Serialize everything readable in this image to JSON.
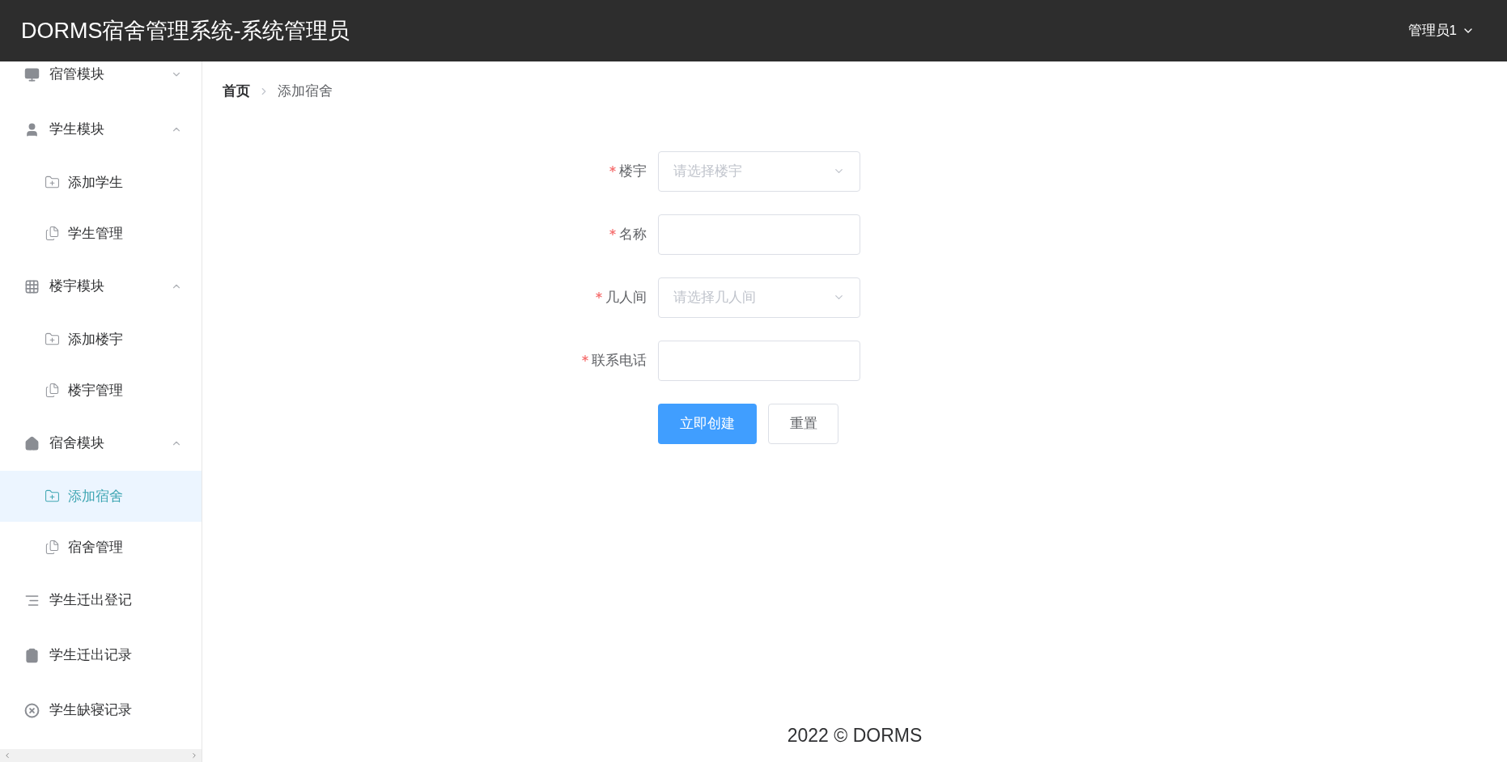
{
  "header": {
    "title": "DORMS宿舍管理系统-系统管理员",
    "user": "管理员1"
  },
  "sidebar": {
    "items": [
      {
        "label": "宿管模块",
        "expanded": false
      },
      {
        "label": "学生模块",
        "expanded": true,
        "children": [
          {
            "label": "添加学生",
            "kind": "add",
            "selected": false
          },
          {
            "label": "学生管理",
            "kind": "manage",
            "selected": false
          }
        ]
      },
      {
        "label": "楼宇模块",
        "expanded": true,
        "children": [
          {
            "label": "添加楼宇",
            "kind": "add",
            "selected": false
          },
          {
            "label": "楼宇管理",
            "kind": "manage",
            "selected": false
          }
        ]
      },
      {
        "label": "宿舍模块",
        "expanded": true,
        "children": [
          {
            "label": "添加宿舍",
            "kind": "add",
            "selected": true
          },
          {
            "label": "宿舍管理",
            "kind": "manage",
            "selected": false
          }
        ]
      },
      {
        "label": "学生迁出登记"
      },
      {
        "label": "学生迁出记录"
      },
      {
        "label": "学生缺寝记录"
      }
    ]
  },
  "breadcrumb": [
    {
      "label": "首页"
    },
    {
      "label": "添加宿舍"
    }
  ],
  "form": {
    "fields": [
      {
        "label": "楼宇",
        "kind": "select",
        "required": true,
        "placeholder": "请选择楼宇"
      },
      {
        "label": "名称",
        "kind": "input",
        "required": true
      },
      {
        "label": "几人间",
        "kind": "select",
        "required": true,
        "placeholder": "请选择几人间"
      },
      {
        "label": "联系电话",
        "kind": "input",
        "required": true
      }
    ],
    "buttons": [
      {
        "label": "立即创建",
        "kind": "primary"
      },
      {
        "label": "重置",
        "kind": "default"
      }
    ]
  },
  "footer": "2022 © DORMS"
}
